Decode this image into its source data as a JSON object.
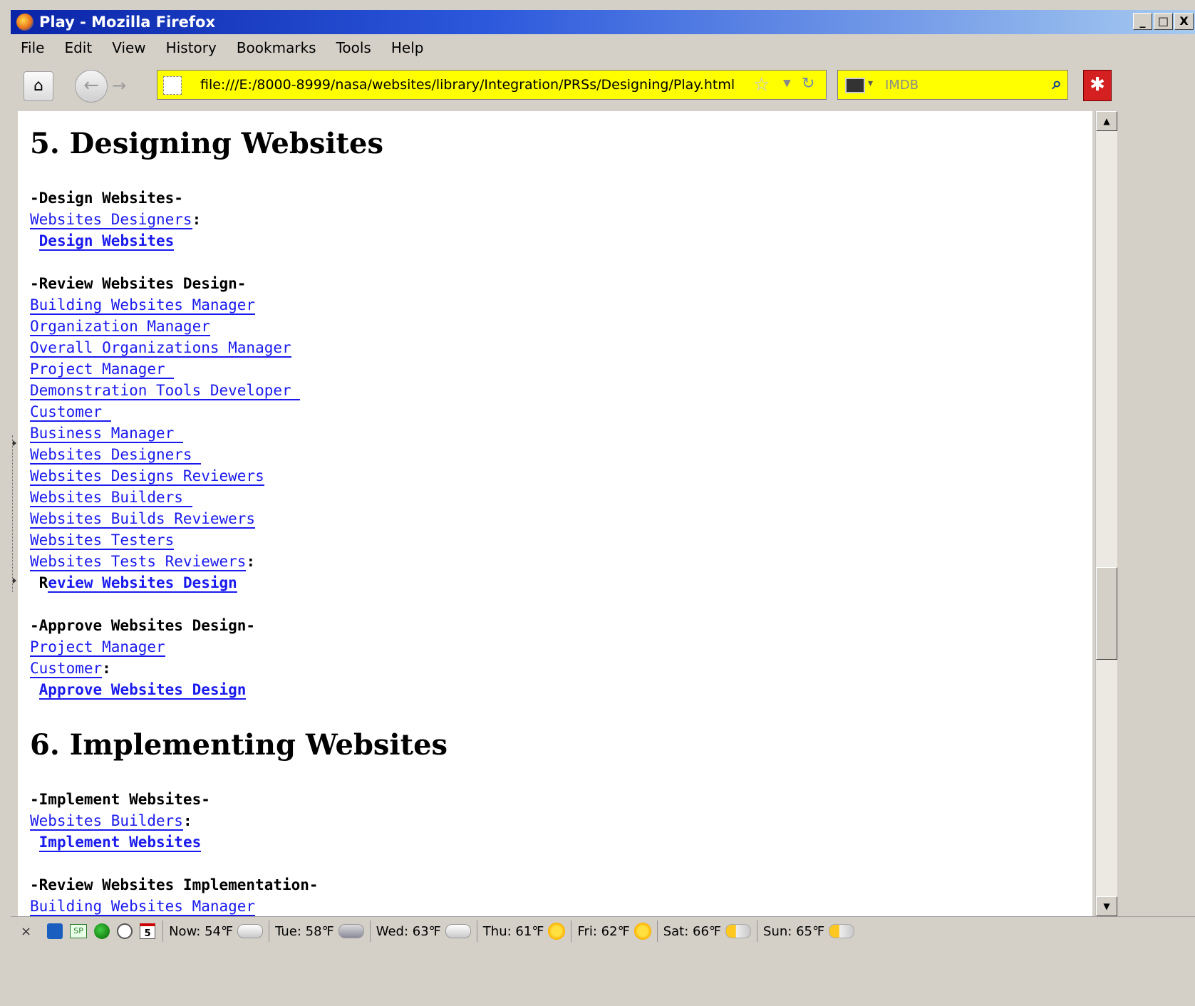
{
  "window": {
    "title": "Play - Mozilla Firefox",
    "controls": {
      "minimize": "_",
      "maximize": "□",
      "close": "X"
    }
  },
  "menu": [
    "File",
    "Edit",
    "View",
    "History",
    "Bookmarks",
    "Tools",
    "Help"
  ],
  "navbar": {
    "url": "file:///E:/8000-8999/nasa/websites/library/Integration/PRSs/Designing/Play.html",
    "search_placeholder": "IMDB"
  },
  "content": {
    "sections": [
      {
        "heading": "5. Designing Websites",
        "groups": [
          {
            "label": "-Design Websites-",
            "roles": [
              "Websites Designers"
            ],
            "action": "Design Websites"
          },
          {
            "label": "-Review Websites Design-",
            "roles": [
              "Building Websites Manager",
              "Organization Manager",
              "Overall Organizations Manager",
              "Project Manager ",
              "Demonstration Tools Developer ",
              "Customer ",
              "Business Manager ",
              "Websites Designers ",
              "Websites Designs Reviewers",
              "Websites Builders ",
              "Websites Builds Reviewers",
              "Websites Testers",
              "Websites Tests Reviewers"
            ],
            "action_prefix": "R",
            "action": "eview Websites Design"
          },
          {
            "label": "-Approve Websites Design-",
            "roles": [
              "Project Manager",
              "Customer"
            ],
            "action": "Approve Websites Design"
          }
        ]
      },
      {
        "heading": "6. Implementing Websites",
        "groups": [
          {
            "label": "-Implement Websites-",
            "roles": [
              "Websites Builders"
            ],
            "action": "Implement Websites"
          },
          {
            "label": "-Review Websites Implementation-",
            "roles": [
              "Building Websites Manager"
            ]
          }
        ]
      }
    ]
  },
  "statusbar": {
    "close": "×",
    "weather": [
      {
        "day": "Now: 54℉",
        "icon": "cloudy-icon"
      },
      {
        "day": "Tue: 58℉",
        "icon": "rain-icon"
      },
      {
        "day": "Wed: 63℉",
        "icon": "partly-cloudy-icon"
      },
      {
        "day": "Thu: 61℉",
        "icon": "sunny-icon"
      },
      {
        "day": "Fri: 62℉",
        "icon": "sunny-icon"
      },
      {
        "day": "Sat: 66℉",
        "icon": "partly-sunny-icon"
      },
      {
        "day": "Sun: 65℉",
        "icon": "partly-sunny-icon"
      }
    ],
    "calendar_day": "5",
    "sp_label": "SP"
  },
  "colors": {
    "link": "#1a1aee",
    "urlbar_bg": "#ffff00",
    "titlebar": "#0a24a8"
  }
}
